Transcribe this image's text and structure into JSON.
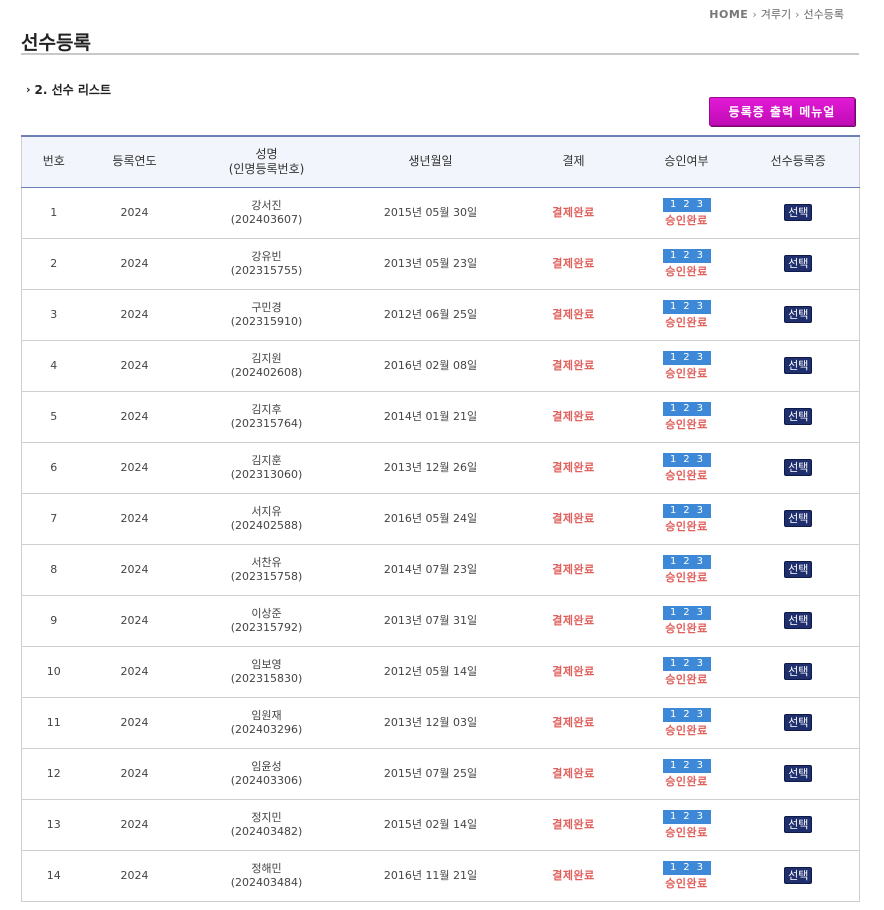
{
  "breadcrumb": {
    "home": "HOME",
    "level1": "겨루기",
    "level2": "선수등록"
  },
  "page_title": "선수등록",
  "section_heading": "2. 선수 리스트",
  "print_menu_label": "등록증 출력 메뉴얼",
  "table": {
    "headers": {
      "no": "번호",
      "year": "등록연도",
      "name_line1": "성명",
      "name_line2": "(인명등록번호)",
      "birth": "생년월일",
      "payment": "결제",
      "approval": "승인여부",
      "cert": "선수등록증"
    },
    "rows": [
      {
        "no": "1",
        "year": "2024",
        "name": "강서진",
        "reg": "(202403607)",
        "birth": "2015년 05월 30일",
        "payment": "결제완료",
        "steps": [
          "1",
          "2",
          "3"
        ],
        "approval": "승인완료",
        "select": "선택"
      },
      {
        "no": "2",
        "year": "2024",
        "name": "강유빈",
        "reg": "(202315755)",
        "birth": "2013년 05월 23일",
        "payment": "결제완료",
        "steps": [
          "1",
          "2",
          "3"
        ],
        "approval": "승인완료",
        "select": "선택"
      },
      {
        "no": "3",
        "year": "2024",
        "name": "구민경",
        "reg": "(202315910)",
        "birth": "2012년 06월 25일",
        "payment": "결제완료",
        "steps": [
          "1",
          "2",
          "3"
        ],
        "approval": "승인완료",
        "select": "선택"
      },
      {
        "no": "4",
        "year": "2024",
        "name": "김지원",
        "reg": "(202402608)",
        "birth": "2016년 02월 08일",
        "payment": "결제완료",
        "steps": [
          "1",
          "2",
          "3"
        ],
        "approval": "승인완료",
        "select": "선택"
      },
      {
        "no": "5",
        "year": "2024",
        "name": "김지후",
        "reg": "(202315764)",
        "birth": "2014년 01월 21일",
        "payment": "결제완료",
        "steps": [
          "1",
          "2",
          "3"
        ],
        "approval": "승인완료",
        "select": "선택"
      },
      {
        "no": "6",
        "year": "2024",
        "name": "김지훈",
        "reg": "(202313060)",
        "birth": "2013년 12월 26일",
        "payment": "결제완료",
        "steps": [
          "1",
          "2",
          "3"
        ],
        "approval": "승인완료",
        "select": "선택"
      },
      {
        "no": "7",
        "year": "2024",
        "name": "서지유",
        "reg": "(202402588)",
        "birth": "2016년 05월 24일",
        "payment": "결제완료",
        "steps": [
          "1",
          "2",
          "3"
        ],
        "approval": "승인완료",
        "select": "선택"
      },
      {
        "no": "8",
        "year": "2024",
        "name": "서찬유",
        "reg": "(202315758)",
        "birth": "2014년 07월 23일",
        "payment": "결제완료",
        "steps": [
          "1",
          "2",
          "3"
        ],
        "approval": "승인완료",
        "select": "선택"
      },
      {
        "no": "9",
        "year": "2024",
        "name": "이상준",
        "reg": "(202315792)",
        "birth": "2013년 07월 31일",
        "payment": "결제완료",
        "steps": [
          "1",
          "2",
          "3"
        ],
        "approval": "승인완료",
        "select": "선택"
      },
      {
        "no": "10",
        "year": "2024",
        "name": "임보영",
        "reg": "(202315830)",
        "birth": "2012년 05월 14일",
        "payment": "결제완료",
        "steps": [
          "1",
          "2",
          "3"
        ],
        "approval": "승인완료",
        "select": "선택"
      },
      {
        "no": "11",
        "year": "2024",
        "name": "임원재",
        "reg": "(202403296)",
        "birth": "2013년 12월 03일",
        "payment": "결제완료",
        "steps": [
          "1",
          "2",
          "3"
        ],
        "approval": "승인완료",
        "select": "선택"
      },
      {
        "no": "12",
        "year": "2024",
        "name": "임윤성",
        "reg": "(202403306)",
        "birth": "2015년 07월 25일",
        "payment": "결제완료",
        "steps": [
          "1",
          "2",
          "3"
        ],
        "approval": "승인완료",
        "select": "선택"
      },
      {
        "no": "13",
        "year": "2024",
        "name": "정지민",
        "reg": "(202403482)",
        "birth": "2015년 02월 14일",
        "payment": "결제완료",
        "steps": [
          "1",
          "2",
          "3"
        ],
        "approval": "승인완료",
        "select": "선택"
      },
      {
        "no": "14",
        "year": "2024",
        "name": "정해민",
        "reg": "(202403484)",
        "birth": "2016년 11월 21일",
        "payment": "결제완료",
        "steps": [
          "1",
          "2",
          "3"
        ],
        "approval": "승인완료",
        "select": "선택"
      }
    ]
  },
  "colors": {
    "accent_magenta": "#d513c9",
    "status_red": "#e0605c",
    "step_blue": "#3d89d8",
    "select_navy": "#1f2f6e",
    "table_border": "#6d7fb8"
  },
  "icons": {
    "breadcrumb_separator": "chevron-right-icon",
    "section_marker": "chevron-right-icon"
  }
}
